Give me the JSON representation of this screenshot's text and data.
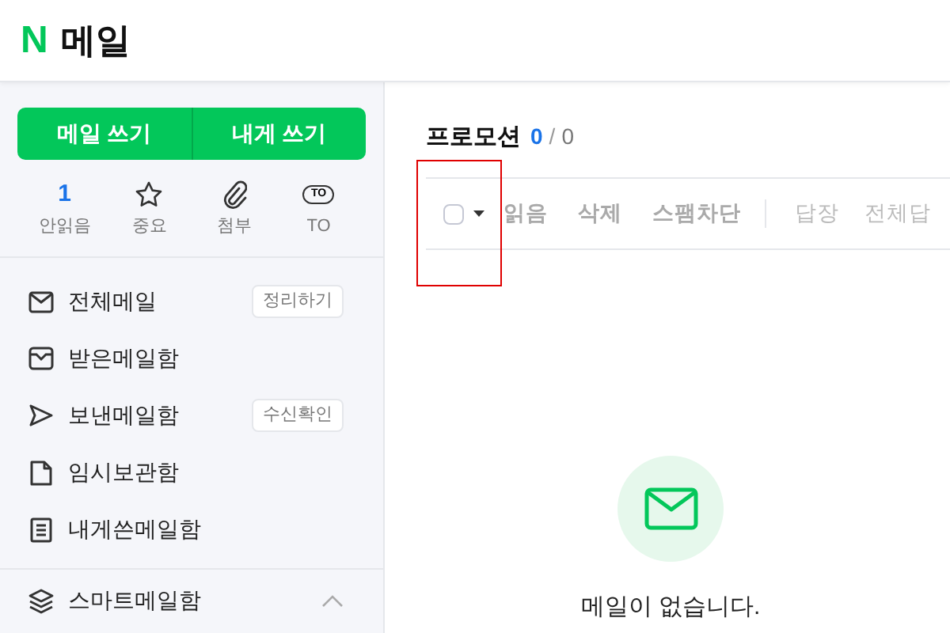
{
  "header": {
    "logo": "N",
    "title": "메일"
  },
  "compose_buttons": [
    "메일 쓰기",
    "내게 쓰기"
  ],
  "quick_filters": [
    {
      "kind": "count",
      "value": "1",
      "label": "안읽음"
    },
    {
      "kind": "star",
      "label": "중요"
    },
    {
      "kind": "clip",
      "label": "첨부"
    },
    {
      "kind": "to",
      "value": "TO",
      "label": "TO"
    }
  ],
  "folders": [
    {
      "kind": "all",
      "label": "전체메일",
      "badge": "정리하기"
    },
    {
      "kind": "inbox",
      "label": "받은메일함"
    },
    {
      "kind": "sent",
      "label": "보낸메일함",
      "badge": "수신확인"
    },
    {
      "kind": "draft",
      "label": "임시보관함"
    },
    {
      "kind": "self",
      "label": "내게쓴메일함"
    }
  ],
  "smart_mailbox": {
    "label": "스마트메일함",
    "expanded": true
  },
  "folder_title": {
    "name": "프로모션",
    "unread": "0",
    "separator": "/",
    "total": "0"
  },
  "toolbar": {
    "select_all_checked": false,
    "actions": [
      "읽음",
      "삭제",
      "스팸차단"
    ],
    "reply_actions": [
      "답장",
      "전체답"
    ]
  },
  "empty_state": {
    "message": "메일이 없습니다."
  }
}
